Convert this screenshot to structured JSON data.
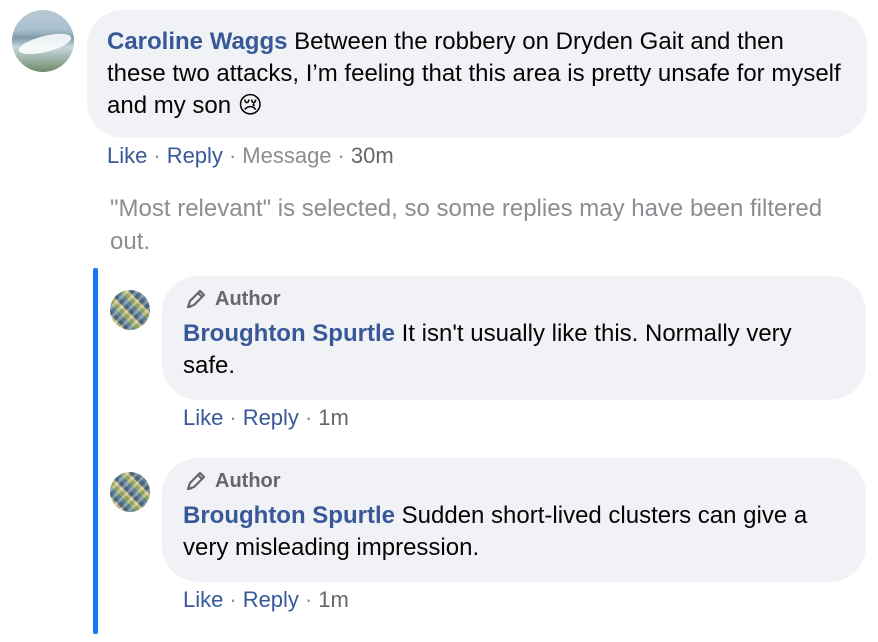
{
  "comment": {
    "author": "Caroline Waggs",
    "text": "Between the robbery on Dryden Gait and then these two attacks, I’m feeling that this area is pretty unsafe for myself and my son",
    "emoji": "😢",
    "actions": {
      "like": "Like",
      "reply": "Reply",
      "message": "Message",
      "time": "30m"
    }
  },
  "filter_notice": "\"Most relevant\" is selected, so some replies may have been filtered out.",
  "replies": [
    {
      "badge": "Author",
      "author": "Broughton Spurtle",
      "text": "It isn't usually like this. Normally very safe.",
      "actions": {
        "like": "Like",
        "reply": "Reply",
        "time": "1m"
      }
    },
    {
      "badge": "Author",
      "author": "Broughton Spurtle",
      "text": "Sudden short-lived clusters can give a very misleading impression.",
      "actions": {
        "like": "Like",
        "reply": "Reply",
        "time": "1m"
      }
    }
  ],
  "colors": {
    "link": "#385898",
    "bubble": "#f0f2f5",
    "muted": "#8a8d91",
    "thread_line": "#1877f2"
  },
  "icons": {
    "author_badge": "pencil-icon"
  }
}
